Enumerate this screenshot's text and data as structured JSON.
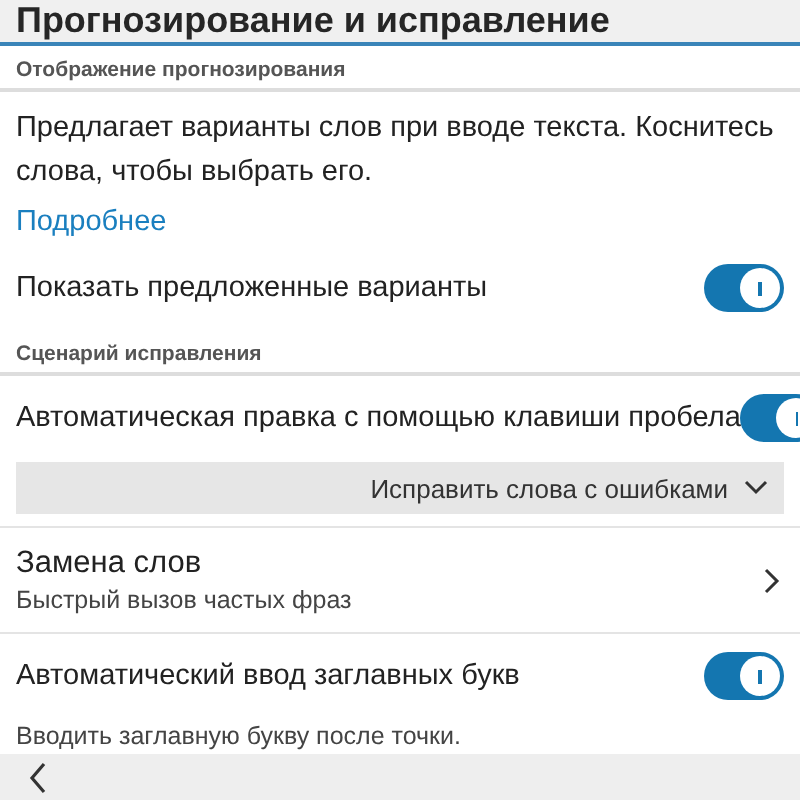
{
  "title": "Прогнозирование и исправление",
  "items": [
    {
      "kind": "header",
      "text": "Отображение прогнозирования"
    },
    {
      "kind": "text",
      "text": "Предлагает варианты слов при вводе текста. Коснитесь слова, чтобы выбрать его."
    },
    {
      "kind": "link",
      "text": "Подробнее"
    },
    {
      "kind": "toggle",
      "text": "Показать предложенные варианты",
      "on": true
    },
    {
      "kind": "header",
      "text": "Сценарий исправления"
    },
    {
      "kind": "toggle",
      "text": "Автоматическая правка с помощью клавиши пробела",
      "on": true
    },
    {
      "kind": "dropdown",
      "text": "Исправить слова с ошибками"
    },
    {
      "kind": "nav",
      "text": "Замена слов",
      "subtitle": "Быстрый вызов частых фраз"
    },
    {
      "kind": "toggle",
      "text": "Автоматический ввод заглавных букв",
      "on": true
    },
    {
      "kind": "note",
      "text": "Вводить заглавную букву после точки."
    }
  ]
}
